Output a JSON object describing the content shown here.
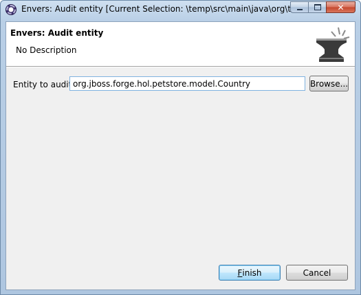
{
  "window": {
    "title": "Envers: Audit entity [Current Selection: \\temp\\src\\main\\java\\org\\temp\\...",
    "icon": "eclipse-app-icon",
    "controls": {
      "minimize": "minimize-icon",
      "maximize": "maximize-icon",
      "close": "✕"
    }
  },
  "banner": {
    "title": "Envers: Audit entity",
    "description": "No Description",
    "image": "anvil-icon"
  },
  "form": {
    "entity_label": "Entity to audit:",
    "required_marker": "*",
    "entity_value": "org.jboss.forge.hol.petstore.model.Country",
    "browse_label": "Browse..."
  },
  "footer": {
    "finish_mnemonic": "F",
    "finish_rest": "inish",
    "cancel_label": "Cancel"
  },
  "colors": {
    "titlebar": "#b9cfe6",
    "dialog_bg": "#f0f0f0",
    "banner_bg": "#ffffff",
    "default_button_border": "#3c7fb1",
    "input_focus_border": "#7fb2e0"
  }
}
